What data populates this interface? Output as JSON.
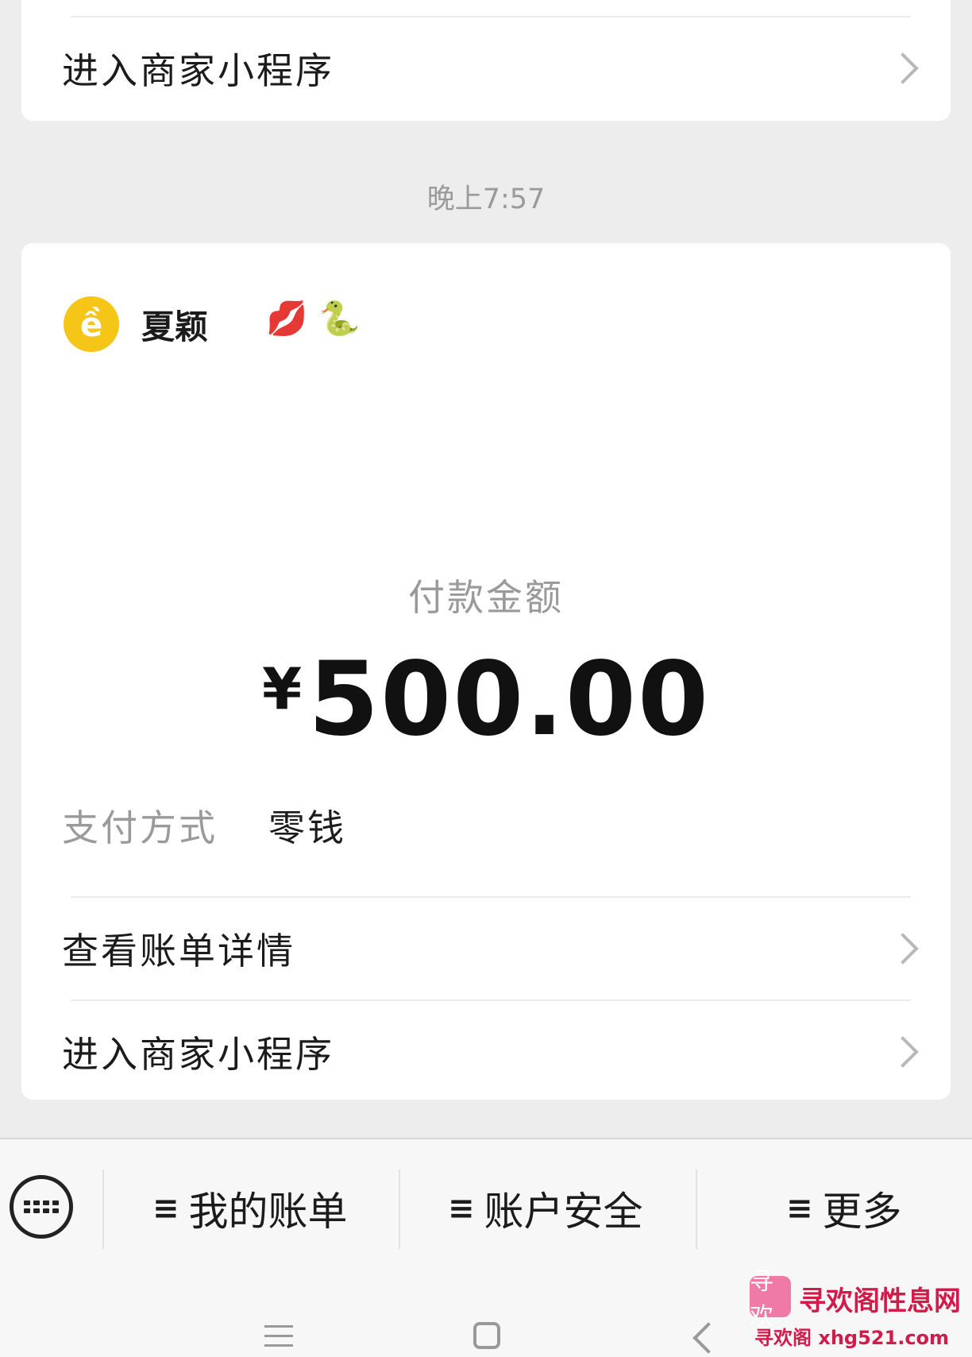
{
  "top_card": {
    "row_label": "进入商家小程序"
  },
  "timestamp": "晚上7:57",
  "payment_card": {
    "merchant": {
      "avatar_glyph": "ề",
      "name": "夏颖",
      "emoji": [
        "💋",
        "🐍"
      ]
    },
    "amount_label": "付款金额",
    "currency_symbol": "¥",
    "amount": "500.00",
    "pay_method_label": "支付方式",
    "pay_method_value": "零钱",
    "rows": [
      {
        "label": "查看账单详情"
      },
      {
        "label": "进入商家小程序"
      }
    ]
  },
  "menu_bar": {
    "items": [
      {
        "label": "我的账单"
      },
      {
        "label": "账户安全"
      },
      {
        "label": "更多"
      }
    ]
  },
  "watermark": {
    "logo_text": "寻欢",
    "line1": "寻欢阁性息网",
    "line2": "寻欢阁 xhg521.com"
  },
  "colors": {
    "background": "#ededed",
    "card": "#ffffff",
    "avatar": "#f5c518",
    "watermark": "#d21b4a"
  }
}
